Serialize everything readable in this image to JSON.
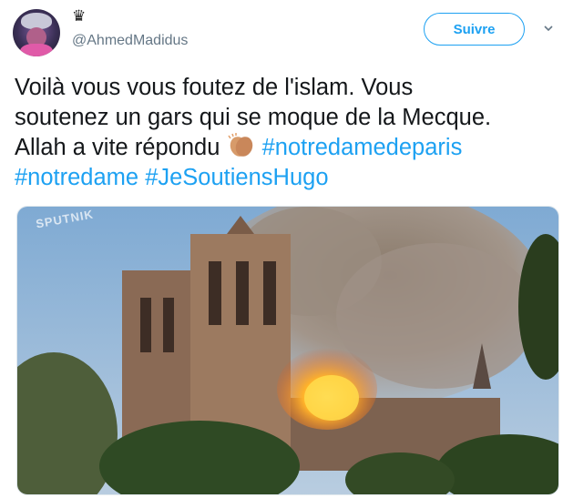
{
  "header": {
    "crown_glyph": "♛",
    "username": "@AhmedMadidus",
    "follow_label": "Suivre"
  },
  "tweet": {
    "line1": "Voilà vous vous foutez de l'islam. Vous",
    "line2": "soutenez un gars qui se moque de la Mecque.",
    "line3_text": "Allah a vite répondu ",
    "hashtags": [
      "#notredamedeparis",
      "#notredame",
      "#JeSoutiensHugo"
    ]
  },
  "media": {
    "watermark": "SPUTNIK"
  },
  "icons": {
    "clap": "clapping-hands-icon",
    "caret": "chevron-down-icon"
  },
  "colors": {
    "accent": "#1da1f2",
    "secondary_text": "#657786"
  }
}
